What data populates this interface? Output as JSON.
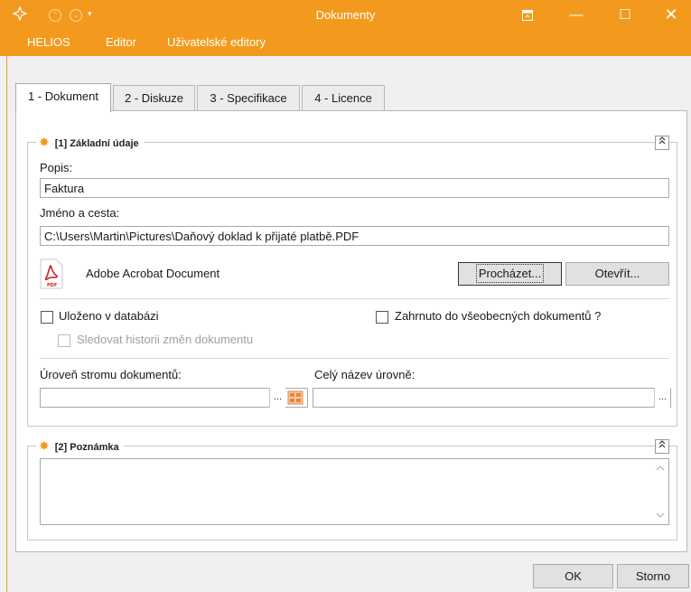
{
  "window": {
    "title": "Dokumenty"
  },
  "menu": [
    {
      "label": "HELIOS"
    },
    {
      "label": "Editor"
    },
    {
      "label": "Uživatelské editory"
    }
  ],
  "tabs": [
    {
      "label": "1 - Dokument"
    },
    {
      "label": "2 - Diskuze"
    },
    {
      "label": "3 - Specifikace"
    },
    {
      "label": "4 - Licence"
    }
  ],
  "group1": {
    "title": "[1] Základní údaje",
    "popis_label": "Popis:",
    "popis_value": "Faktura",
    "path_label": "Jméno a cesta:",
    "path_value": "C:\\Users\\Martin\\Pictures\\Daňový doklad k přijaté platbě.PDF",
    "doc_type": "Adobe Acrobat Document",
    "pdf_label": "PDF",
    "browse_label": "Procházet...",
    "open_label": "Otevřít...",
    "saved_label": "Uloženo v databázi",
    "history_label": "Sledovat historii změn dokumentu",
    "general_label": "Zahrnuto do všeobecných dokumentů ?",
    "tree_label": "Úroveň stromu dokumentů:",
    "tree_value": "",
    "fullname_label": "Celý název úrovně:",
    "fullname_value": "",
    "dots": "..."
  },
  "group2": {
    "title": "[2] Poznámka",
    "note_value": ""
  },
  "footer": {
    "ok_label": "OK",
    "cancel_label": "Storno"
  },
  "colors": {
    "accent": "#f39a1e"
  }
}
